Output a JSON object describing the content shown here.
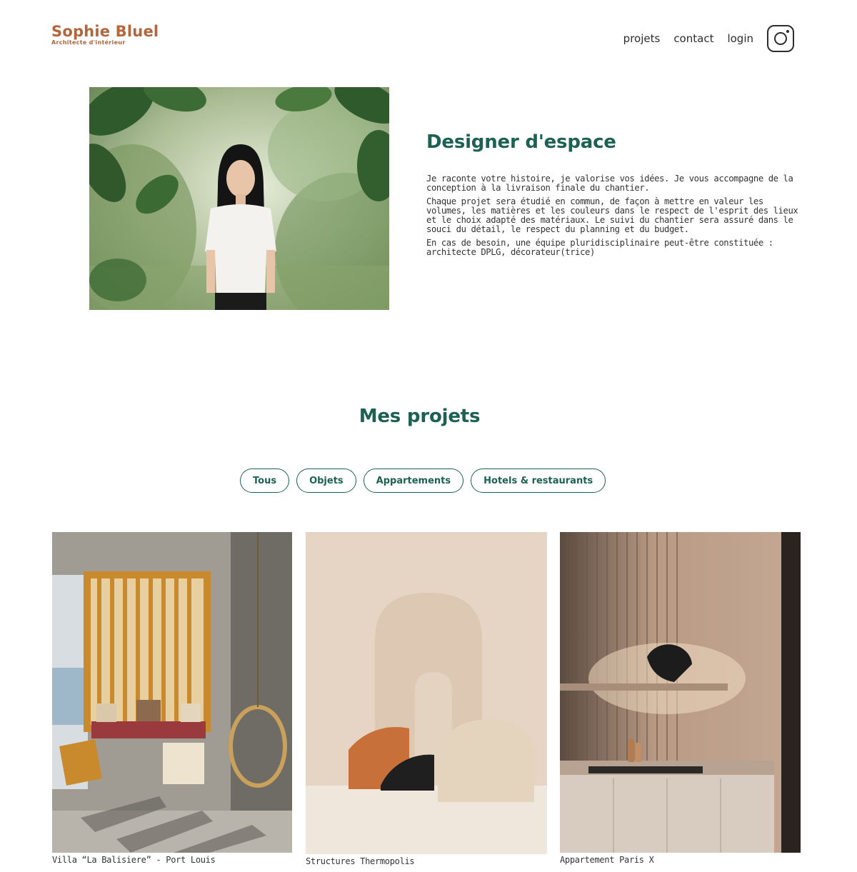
{
  "header": {
    "brand_title": "Sophie Bluel",
    "brand_subtitle": "Architecte d'intérieur",
    "nav": [
      "projets",
      "contact",
      "login"
    ],
    "social_icon": "instagram-icon"
  },
  "intro": {
    "title": "Designer d'espace",
    "paragraphs": [
      "Je raconte votre histoire, je valorise vos idées. Je vous accompagne de la conception à la livraison finale du chantier.",
      "Chaque projet sera étudié en commun, de façon à mettre en valeur les volumes, les matières et les couleurs dans le respect de l'esprit des lieux et le choix adapté des matériaux. Le suivi du chantier sera assuré dans le souci du détail, le respect du planning et du budget.",
      "En cas de besoin, une équipe pluridisciplinaire peut-être constituée : architecte DPLG, décorateur(trice)"
    ]
  },
  "projects": {
    "title": "Mes projets",
    "filters": [
      "Tous",
      "Objets",
      "Appartements",
      "Hotels & restaurants"
    ],
    "items": [
      {
        "caption": "Villa “La Balisiere” - Port Louis"
      },
      {
        "caption": "Structures Thermopolis"
      },
      {
        "caption": "Appartement Paris X"
      }
    ]
  },
  "colors": {
    "brand": "#B1663C",
    "accent": "#1D6154"
  }
}
